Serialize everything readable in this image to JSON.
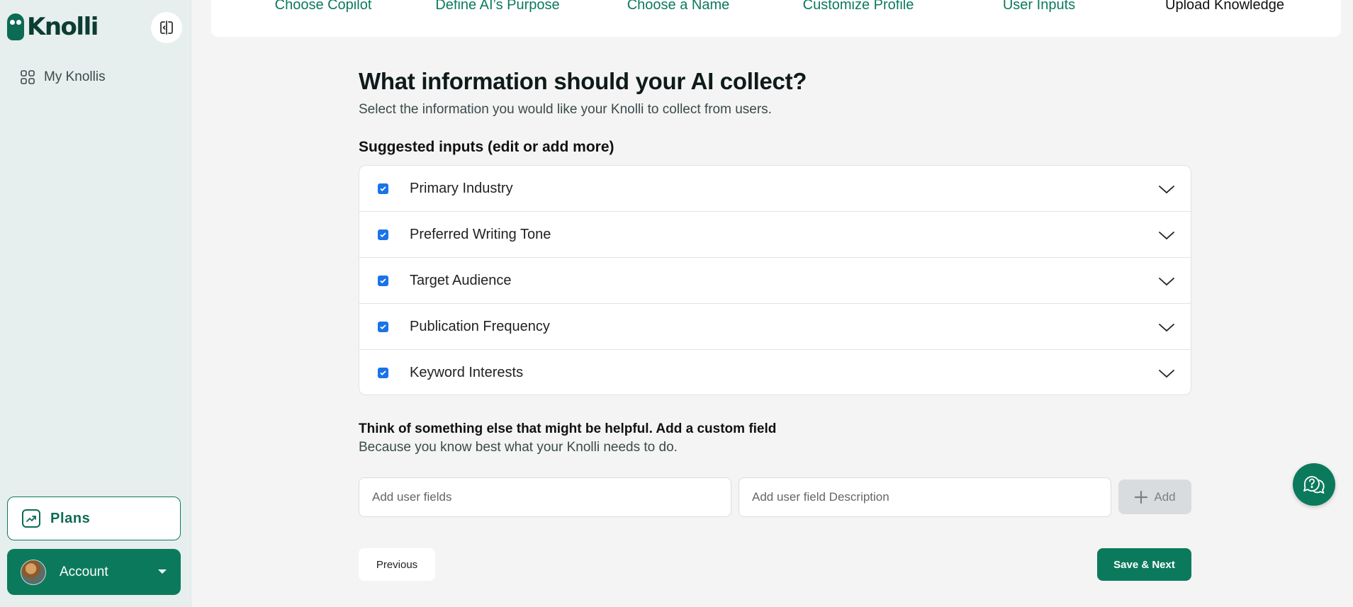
{
  "brand": {
    "name": "Knolli",
    "accent": "#0b7a5c"
  },
  "sidebar": {
    "nav": [
      {
        "label": "My Knollis",
        "icon": "grid-icon"
      }
    ],
    "plans_label": "Plans",
    "account_label": "Account"
  },
  "steps": [
    {
      "label": "Choose Copilot",
      "active": false
    },
    {
      "label": "Define AI’s Purpose",
      "active": false
    },
    {
      "label": "Choose a Name",
      "active": false
    },
    {
      "label": "Customize Profile",
      "active": false
    },
    {
      "label": "User Inputs",
      "active": false
    },
    {
      "label": "Upload Knowledge",
      "active": true
    }
  ],
  "main": {
    "title": "What information should your AI collect?",
    "subtitle": "Select the information you would like your Knolli to collect from users.",
    "suggested_title": "Suggested inputs (edit or add more)",
    "inputs": [
      {
        "label": "Primary Industry",
        "checked": true
      },
      {
        "label": "Preferred Writing Tone",
        "checked": true
      },
      {
        "label": "Target Audience",
        "checked": true
      },
      {
        "label": "Publication Frequency",
        "checked": true
      },
      {
        "label": "Keyword Interests",
        "checked": true
      }
    ],
    "custom_title": "Think of something else that might be helpful. Add a custom field",
    "custom_subtitle": "Because you know best what your Knolli needs to do.",
    "field_name_placeholder": "Add user fields",
    "field_desc_placeholder": "Add user field Description",
    "add_label": "Add",
    "previous_label": "Previous",
    "next_label": "Save & Next"
  }
}
